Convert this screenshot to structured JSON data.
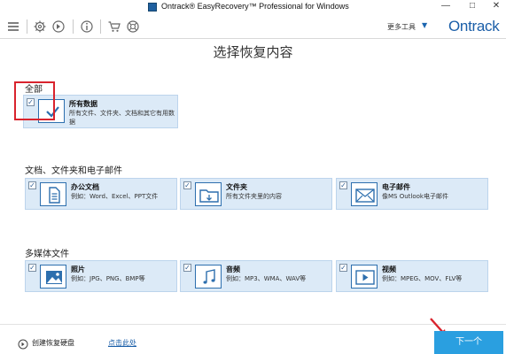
{
  "window": {
    "title": "Ontrack® EasyRecovery™ Professional for Windows",
    "minimize": "—",
    "maximize": "□",
    "close": "✕"
  },
  "toolbar": {
    "icons": [
      "menu-icon",
      "gear-icon",
      "recover-disc-icon",
      "info-icon",
      "cart-icon",
      "help-icon"
    ],
    "more_tools": "更多工具",
    "more_tools_caret": "▼",
    "logo": "Ontrack"
  },
  "page": {
    "title": "选择恢复内容"
  },
  "sections": [
    {
      "heading": "全部",
      "items": [
        {
          "title": "所有数据",
          "desc": "所有文件、文件夹、文档和其它有用数据",
          "icon": "checkmark-icon",
          "checked": true
        }
      ]
    },
    {
      "heading": "文档、文件夹和电子邮件",
      "items": [
        {
          "title": "办公文档",
          "desc": "例如：Word、Excel、PPT文件",
          "icon": "document-icon",
          "checked": true
        },
        {
          "title": "文件夹",
          "desc": "所有文件夹里的内容",
          "icon": "folder-icon",
          "checked": true
        },
        {
          "title": "电子邮件",
          "desc": "像MS Outlook电子邮件",
          "icon": "mail-icon",
          "checked": true
        }
      ]
    },
    {
      "heading": "多媒体文件",
      "items": [
        {
          "title": "照片",
          "desc": "例如：JPG、PNG、BMP等",
          "icon": "photo-icon",
          "checked": true
        },
        {
          "title": "音频",
          "desc": "例如：MP3、WMA、WAV等",
          "icon": "music-icon",
          "checked": true
        },
        {
          "title": "视频",
          "desc": "例如：MPEG、MOV、FLV等",
          "icon": "video-icon",
          "checked": true
        }
      ]
    }
  ],
  "footer": {
    "create_disk": "创建恢复硬盘",
    "click_here": "点击此处",
    "next": "下一个"
  },
  "colors": {
    "accent": "#2a9fe0",
    "card_bg": "#dceaf7",
    "icon_blue": "#2d6fae",
    "highlight_red": "#d9232d",
    "logo_blue": "#1a5ea8"
  }
}
